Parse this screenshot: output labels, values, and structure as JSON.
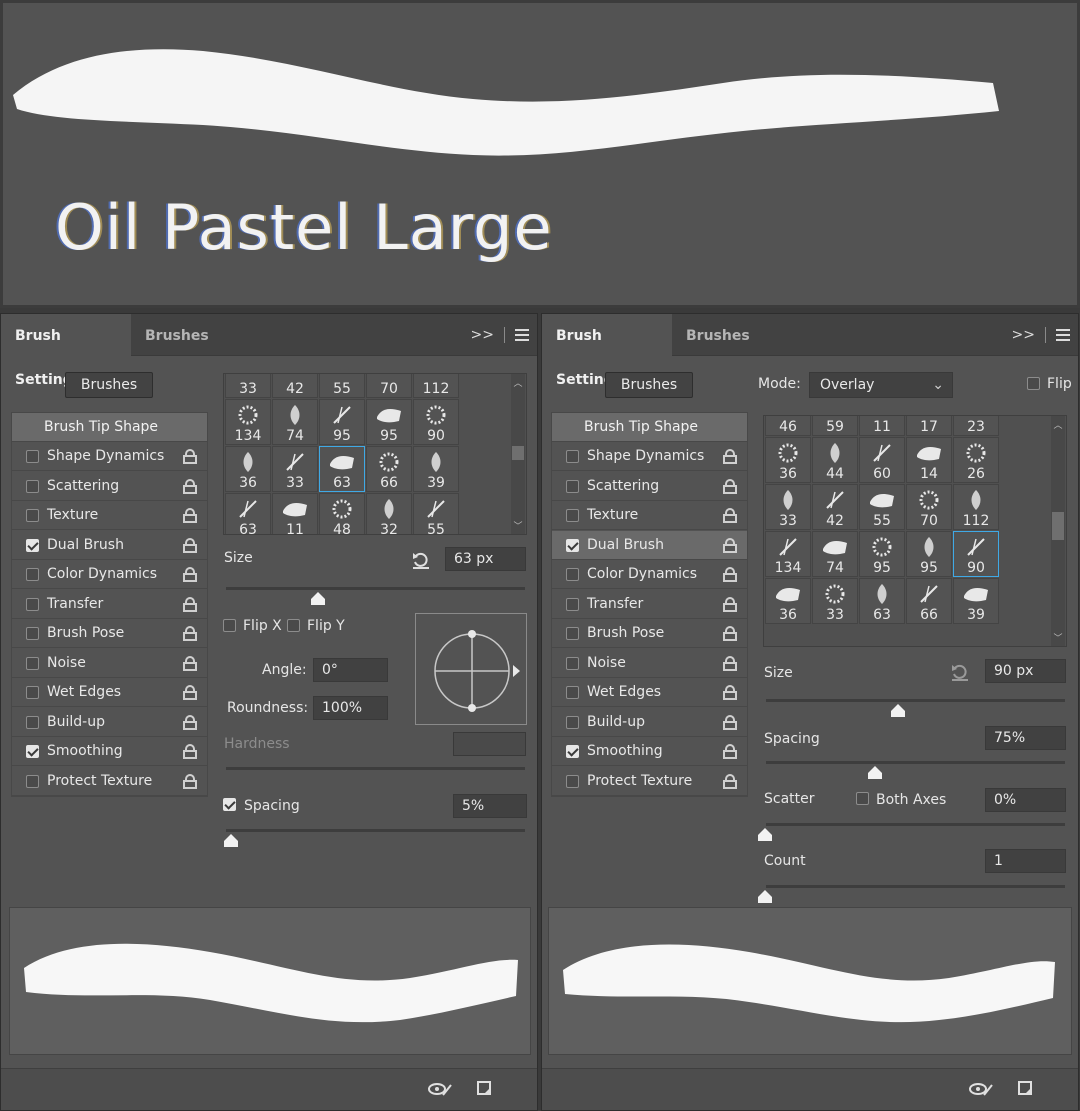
{
  "hero": {
    "title": "Oil Pastel Large"
  },
  "left_panel": {
    "tabs": {
      "active": "Brush Settings",
      "inactive": "Brushes"
    },
    "overflow_glyph": ">>",
    "brushes_button": "Brushes",
    "list": {
      "header": "Brush Tip Shape",
      "items": [
        {
          "label": "Shape Dynamics",
          "checked": false
        },
        {
          "label": "Scattering",
          "checked": false
        },
        {
          "label": "Texture",
          "checked": false
        },
        {
          "label": "Dual Brush",
          "checked": true
        },
        {
          "label": "Color Dynamics",
          "checked": false
        },
        {
          "label": "Transfer",
          "checked": false
        },
        {
          "label": "Brush Pose",
          "checked": false
        },
        {
          "label": "Noise",
          "checked": false
        },
        {
          "label": "Wet Edges",
          "checked": false
        },
        {
          "label": "Build-up",
          "checked": false
        },
        {
          "label": "Smoothing",
          "checked": true
        },
        {
          "label": "Protect Texture",
          "checked": false
        }
      ]
    },
    "grid": [
      [
        "33",
        "42",
        "55",
        "70",
        "112"
      ],
      [
        "134",
        "74",
        "95",
        "95",
        "90"
      ],
      [
        "36",
        "33",
        "63",
        "66",
        "39"
      ],
      [
        "63",
        "11",
        "48",
        "32",
        "55"
      ]
    ],
    "grid_selected": "63",
    "size_label": "Size",
    "size_value": "63 px",
    "flipx_label": "Flip X",
    "flipy_label": "Flip Y",
    "angle_label": "Angle:",
    "angle_value": "0°",
    "roundness_label": "Roundness:",
    "roundness_value": "100%",
    "hardness_label": "Hardness",
    "spacing_label": "Spacing",
    "spacing_checked": true,
    "spacing_value": "5%"
  },
  "right_panel": {
    "tabs": {
      "active": "Brush Settings",
      "inactive": "Brushes"
    },
    "overflow_glyph": ">>",
    "brushes_button": "Brushes",
    "mode_label": "Mode:",
    "mode_value": "Overlay",
    "flip_label": "Flip",
    "list": {
      "header": "Brush Tip Shape",
      "items": [
        {
          "label": "Shape Dynamics",
          "checked": false
        },
        {
          "label": "Scattering",
          "checked": false
        },
        {
          "label": "Texture",
          "checked": false
        },
        {
          "label": "Dual Brush",
          "checked": true
        },
        {
          "label": "Color Dynamics",
          "checked": false
        },
        {
          "label": "Transfer",
          "checked": false
        },
        {
          "label": "Brush Pose",
          "checked": false
        },
        {
          "label": "Noise",
          "checked": false
        },
        {
          "label": "Wet Edges",
          "checked": false
        },
        {
          "label": "Build-up",
          "checked": false
        },
        {
          "label": "Smoothing",
          "checked": true
        },
        {
          "label": "Protect Texture",
          "checked": false
        }
      ]
    },
    "grid": [
      [
        "46",
        "59",
        "11",
        "17",
        "23"
      ],
      [
        "36",
        "44",
        "60",
        "14",
        "26"
      ],
      [
        "33",
        "42",
        "55",
        "70",
        "112"
      ],
      [
        "134",
        "74",
        "95",
        "95",
        "90"
      ],
      [
        "36",
        "33",
        "63",
        "66",
        "39"
      ]
    ],
    "grid_selected": "90",
    "size_label": "Size",
    "size_value": "90 px",
    "spacing_label": "Spacing",
    "spacing_value": "75%",
    "scatter_label": "Scatter",
    "both_axes_label": "Both Axes",
    "scatter_value": "0%",
    "count_label": "Count",
    "count_value": "1"
  },
  "colors": {
    "panel": "#535353",
    "tabbar": "#424242",
    "field": "#414141",
    "selection": "#3fa9e6"
  }
}
